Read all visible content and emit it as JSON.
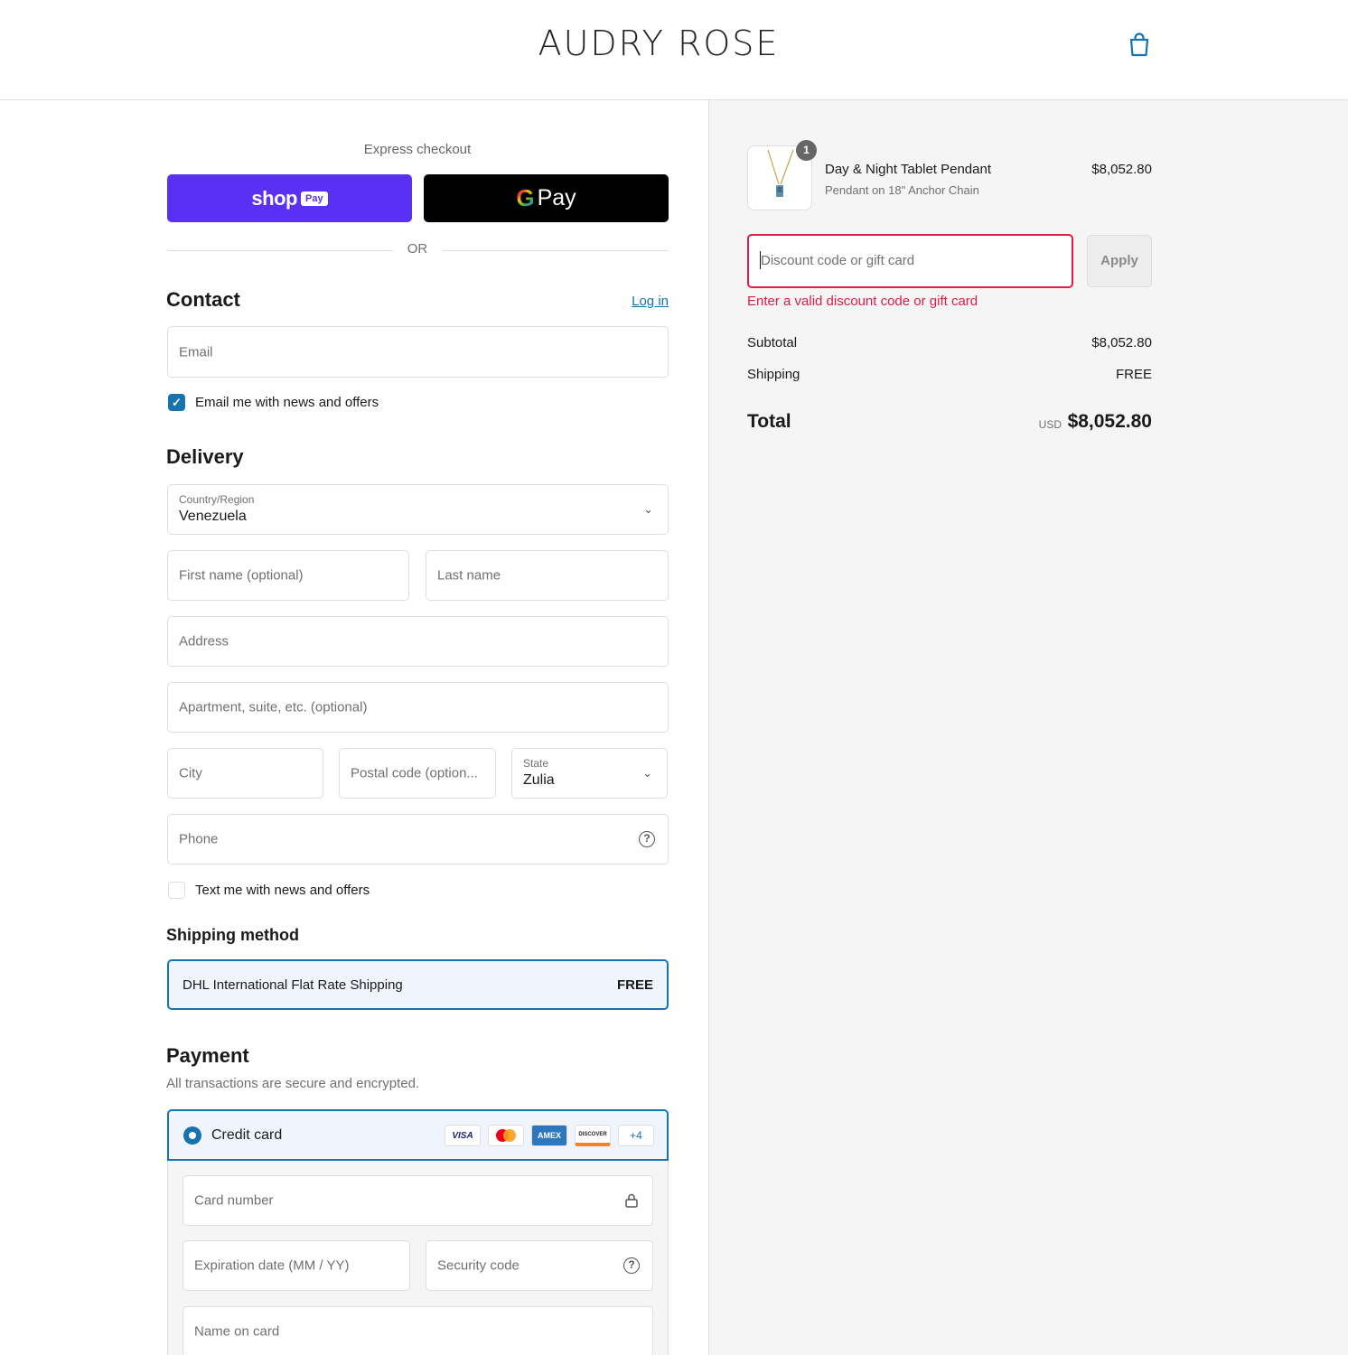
{
  "header": {
    "brand": "AUDRY ROSE",
    "cart_icon": "shopping-bag-icon"
  },
  "express": {
    "label": "Express checkout",
    "shop_pay": {
      "word": "shop",
      "chip": "Pay"
    },
    "google_pay": {
      "g": "G",
      "word": "Pay"
    },
    "or": "OR"
  },
  "contact": {
    "title": "Contact",
    "login_link": "Log in",
    "email_placeholder": "Email",
    "newsletter_label": "Email me with news and offers",
    "newsletter_checked": true
  },
  "delivery": {
    "title": "Delivery",
    "country_label": "Country/Region",
    "country_value": "Venezuela",
    "first_name_placeholder": "First name (optional)",
    "last_name_placeholder": "Last name",
    "address_placeholder": "Address",
    "apartment_placeholder": "Apartment, suite, etc. (optional)",
    "city_placeholder": "City",
    "postal_placeholder": "Postal code (option...",
    "state_label": "State",
    "state_value": "Zulia",
    "phone_placeholder": "Phone",
    "sms_label": "Text me with news and offers",
    "sms_checked": false
  },
  "shipping": {
    "title": "Shipping method",
    "option_name": "DHL International Flat Rate Shipping",
    "option_price": "FREE"
  },
  "payment": {
    "title": "Payment",
    "subtitle": "All transactions are secure and encrypted.",
    "method_label": "Credit card",
    "card_logos": {
      "visa": "VISA",
      "amex": "AMEX",
      "discover": "DISCOVER",
      "more": "+4"
    },
    "card_number_placeholder": "Card number",
    "expiration_placeholder": "Expiration date (MM / YY)",
    "security_placeholder": "Security code",
    "name_placeholder": "Name on card"
  },
  "summary": {
    "product": {
      "quantity": "1",
      "title": "Day & Night Tablet Pendant",
      "variant": "Pendant on 18\" Anchor Chain",
      "price": "$8,052.80"
    },
    "discount_placeholder": "Discount code or gift card",
    "apply_label": "Apply",
    "discount_error": "Enter a valid discount code or gift card",
    "subtotal_label": "Subtotal",
    "subtotal_value": "$8,052.80",
    "shipping_label": "Shipping",
    "shipping_value": "FREE",
    "total_label": "Total",
    "total_currency": "USD",
    "total_value": "$8,052.80"
  },
  "colors": {
    "accent": "#1773b0",
    "shop_pay": "#5a31f4",
    "error": "#dd1d4a",
    "summary_bg": "#f5f5f5"
  }
}
